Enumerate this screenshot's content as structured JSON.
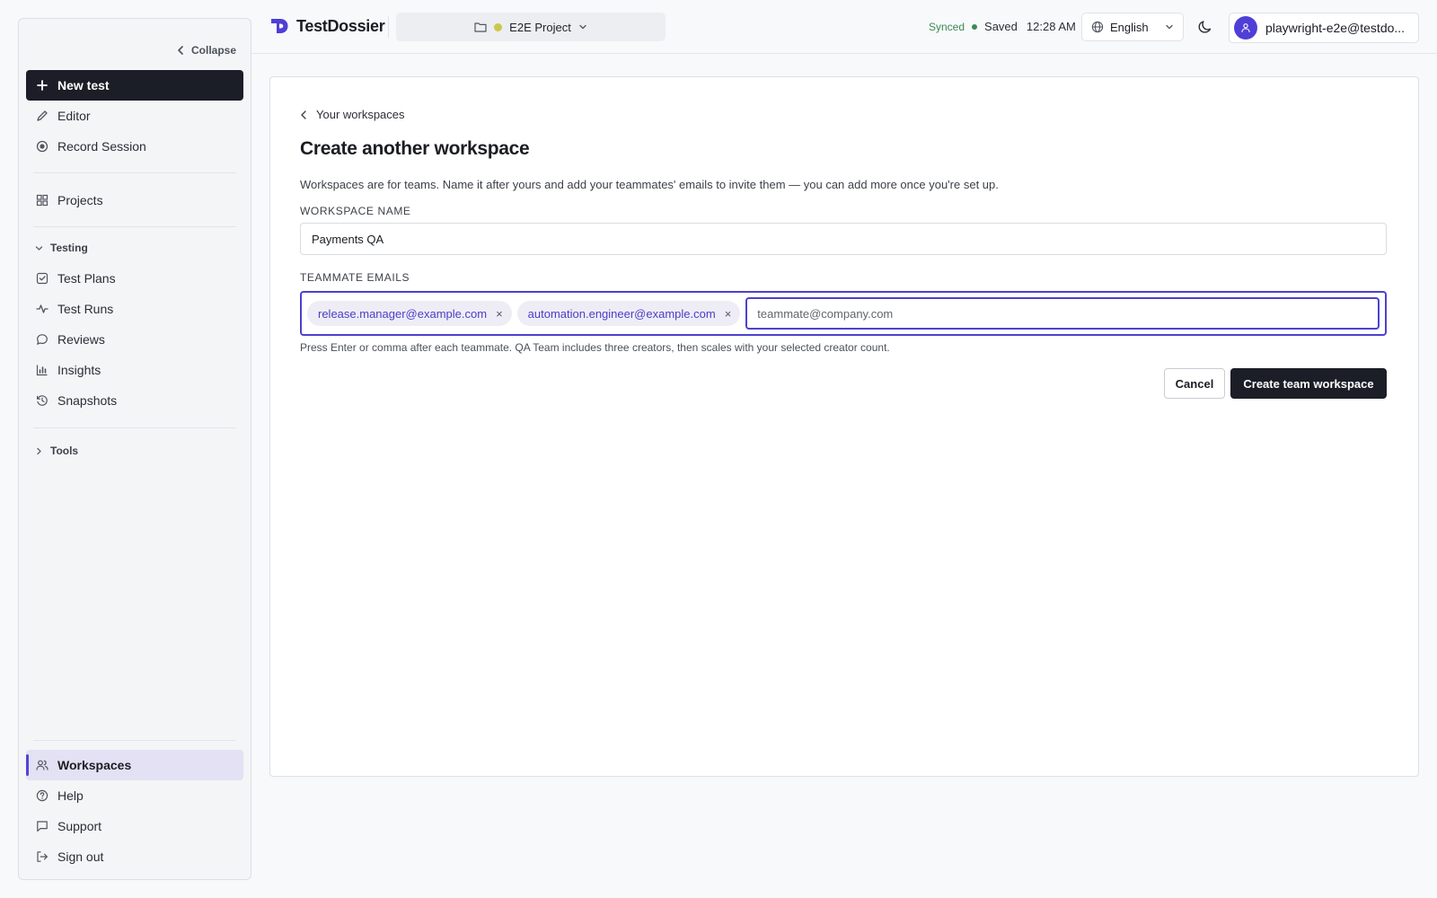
{
  "app": {
    "name": "TestDossier",
    "accent_color": "#4f3fd6",
    "primary_button_color": "#1b1e27"
  },
  "sidebar": {
    "collapse_label": "Collapse",
    "new_test_label": "New test",
    "top_items": [
      {
        "label": "Editor",
        "icon": "pencil-icon"
      },
      {
        "label": "Record Session",
        "icon": "record-icon"
      }
    ],
    "projects_label": "Projects",
    "testing_section": {
      "label": "Testing",
      "expanded": true,
      "items": [
        {
          "label": "Test Plans",
          "icon": "checklist-icon"
        },
        {
          "label": "Test Runs",
          "icon": "activity-icon"
        },
        {
          "label": "Reviews",
          "icon": "chat-bubble-icon"
        },
        {
          "label": "Insights",
          "icon": "bar-chart-icon"
        },
        {
          "label": "Snapshots",
          "icon": "history-icon"
        }
      ]
    },
    "tools_section": {
      "label": "Tools",
      "expanded": false
    },
    "bottom_items": [
      {
        "label": "Workspaces",
        "icon": "users-icon",
        "active": true
      },
      {
        "label": "Help",
        "icon": "help-circle-icon"
      },
      {
        "label": "Support",
        "icon": "message-square-icon"
      },
      {
        "label": "Sign out",
        "icon": "sign-out-icon"
      }
    ]
  },
  "header": {
    "project_name": "E2E Project",
    "project_status_color": "#c9c84a",
    "sync_status": "Synced",
    "save_status": "Saved",
    "time": "12:28 AM",
    "language": "English",
    "account_email": "playwright-e2e@testdo..."
  },
  "main": {
    "back_label": "Your workspaces",
    "title": "Create another workspace",
    "description": "Workspaces are for teams. Name it after yours and add your teammates' emails to invite them — you can add more once you're set up.",
    "workspace_name_label": "WORKSPACE NAME",
    "workspace_name_value": "Payments QA",
    "teammate_emails_label": "TEAMMATE EMAILS",
    "emails": [
      "release.manager@example.com",
      "automation.engineer@example.com"
    ],
    "email_placeholder": "teammate@company.com",
    "helper_text": "Press Enter or comma after each teammate. QA Team includes three creators, then scales with your selected creator count.",
    "cancel_label": "Cancel",
    "create_label": "Create team workspace"
  }
}
